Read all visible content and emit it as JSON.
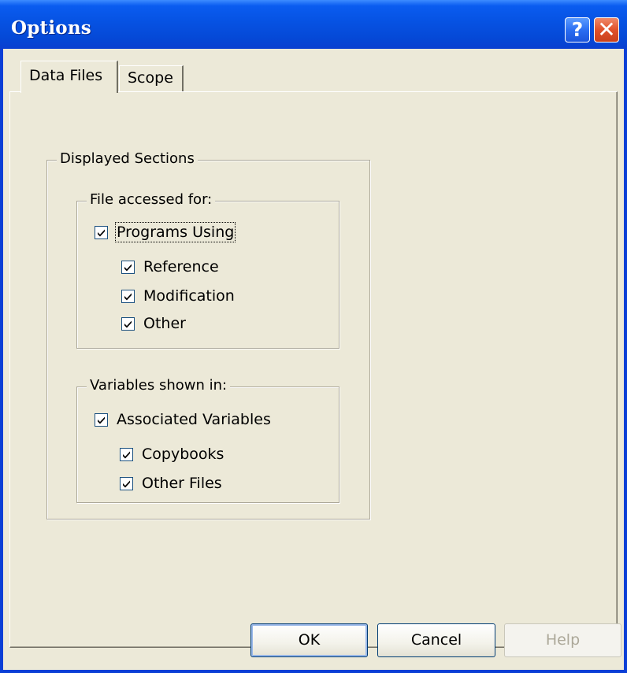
{
  "window": {
    "title": "Options"
  },
  "tabs": [
    {
      "label": "Data Files",
      "active": true
    },
    {
      "label": "Scope",
      "active": false
    }
  ],
  "displayed_sections": {
    "label": "Displayed Sections",
    "file_accessed_for": {
      "label": "File accessed for:",
      "programs_using": {
        "label": "Programs Using",
        "checked": true
      },
      "items": [
        {
          "label": "Reference",
          "checked": true
        },
        {
          "label": "Modification",
          "checked": true
        },
        {
          "label": "Other",
          "checked": true
        }
      ]
    },
    "variables_shown_in": {
      "label": "Variables shown in:",
      "associated_variables": {
        "label": "Associated Variables",
        "checked": true
      },
      "items": [
        {
          "label": "Copybooks",
          "checked": true
        },
        {
          "label": "Other Files",
          "checked": true
        }
      ]
    }
  },
  "buttons": {
    "ok": "OK",
    "cancel": "Cancel",
    "help": "Help"
  },
  "titlebar_buttons": {
    "help_glyph": "?",
    "close_glyph": "✕"
  }
}
